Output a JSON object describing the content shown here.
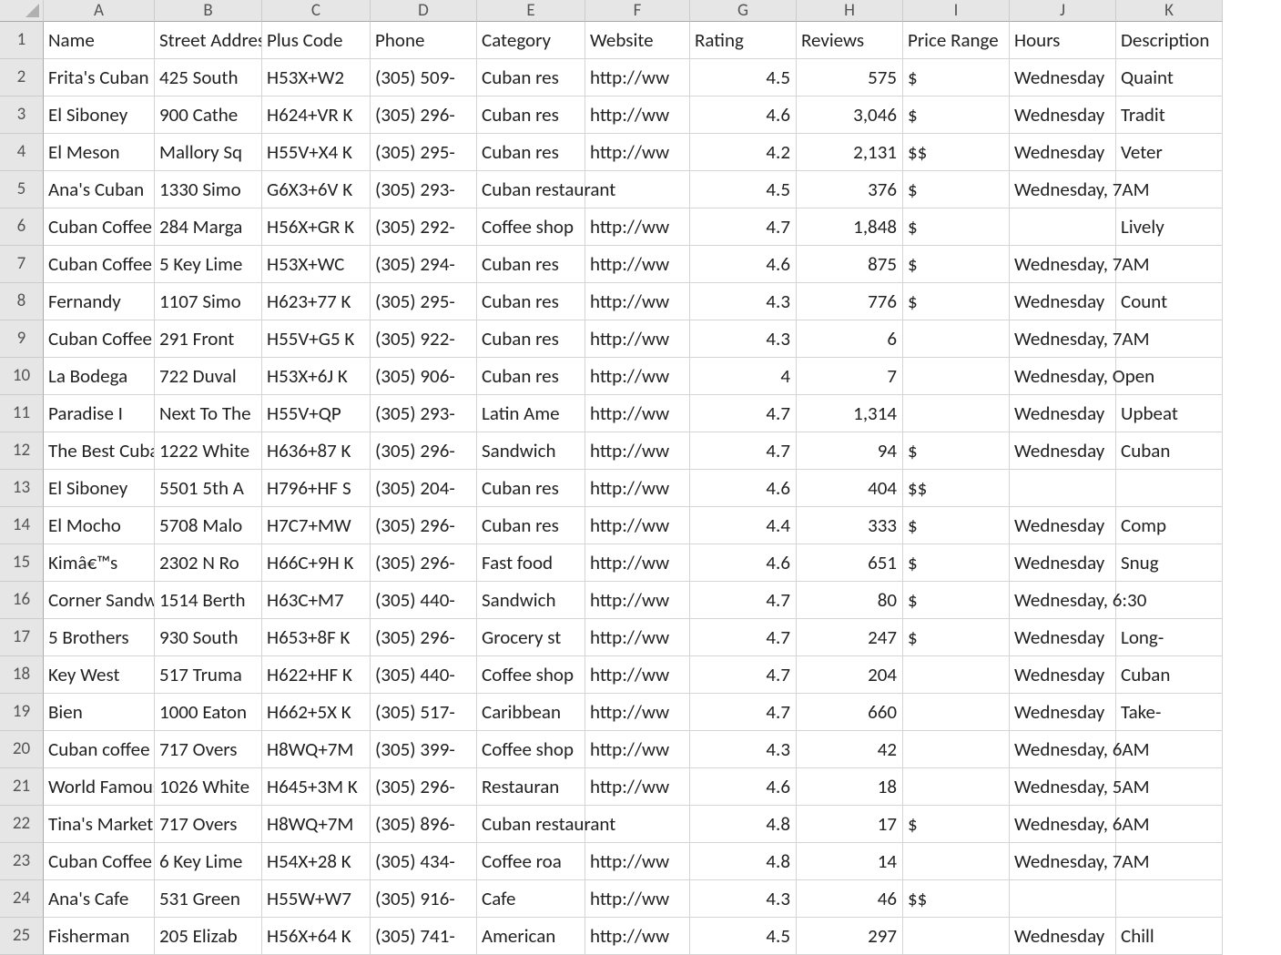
{
  "columns": [
    "A",
    "B",
    "C",
    "D",
    "E",
    "F",
    "G",
    "H",
    "I",
    "J",
    "K"
  ],
  "headers": {
    "A": "Name",
    "B": "Street Address",
    "C": "Plus Code",
    "D": "Phone",
    "E": "Category",
    "F": "Website",
    "G": "Rating",
    "H": "Reviews",
    "I": "Price Range",
    "J": "Hours",
    "K": "Description"
  },
  "rows": [
    {
      "n": "1",
      "A": "Name",
      "B": "Street Address",
      "C": "Plus Code",
      "D": "Phone",
      "E": "Category",
      "F": "Website",
      "G": "Rating",
      "H": "Reviews",
      "I": "Price Range",
      "J": "Hours",
      "K": "Description"
    },
    {
      "n": "2",
      "A": "Frita's Cuban",
      "B": "425 South",
      "C": "H53X+W2",
      "D": "(305) 509-",
      "E": "Cuban res",
      "F": "http://ww",
      "G": "4.5",
      "H": "575",
      "I": "$",
      "J": "Wednesday",
      "K": "Quaint"
    },
    {
      "n": "3",
      "A": "El Siboney",
      "B": "900 Cathe",
      "C": "H624+VR K",
      "D": "(305) 296-",
      "E": "Cuban res",
      "F": "http://ww",
      "G": "4.6",
      "H": "3,046",
      "I": "$",
      "J": "Wednesday",
      "K": "Tradit"
    },
    {
      "n": "4",
      "A": "El Meson",
      "B": "Mallory Sq",
      "C": "H55V+X4 K",
      "D": "(305) 295-",
      "E": "Cuban res",
      "F": "http://ww",
      "G": "4.2",
      "H": "2,131",
      "I": "$$",
      "J": "Wednesday",
      "K": "Veter"
    },
    {
      "n": "5",
      "A": "Ana's Cuban",
      "B": "1330 Simo",
      "C": "G6X3+6V K",
      "D": "(305) 293-",
      "E": "Cuban restaurant",
      "F": "",
      "G": "4.5",
      "H": "376",
      "I": "$",
      "J": "Wednesday, 7AM",
      "K": ""
    },
    {
      "n": "6",
      "A": "Cuban Coffee",
      "B": "284 Marga",
      "C": "H56X+GR K",
      "D": "(305) 292-",
      "E": "Coffee shop",
      "F": "http://ww",
      "G": "4.7",
      "H": "1,848",
      "I": "$",
      "J": "",
      "K": "Lively"
    },
    {
      "n": "7",
      "A": "Cuban Coffee",
      "B": "5 Key Lime",
      "C": "H53X+WC",
      "D": "(305) 294-",
      "E": "Cuban res",
      "F": "http://ww",
      "G": "4.6",
      "H": "875",
      "I": "$",
      "J": "Wednesday, 7AM",
      "K": ""
    },
    {
      "n": "8",
      "A": "Fernandy",
      "B": "1107 Simo",
      "C": "H623+77 K",
      "D": "(305) 295-",
      "E": "Cuban res",
      "F": "http://ww",
      "G": "4.3",
      "H": "776",
      "I": "$",
      "J": "Wednesday",
      "K": "Count"
    },
    {
      "n": "9",
      "A": "Cuban Coffee",
      "B": "291 Front",
      "C": "H55V+G5 K",
      "D": "(305) 922-",
      "E": "Cuban res",
      "F": "http://ww",
      "G": "4.3",
      "H": "6",
      "I": "",
      "J": "Wednesday, 7AM",
      "K": ""
    },
    {
      "n": "10",
      "A": "La Bodega",
      "B": "722 Duval",
      "C": "H53X+6J K",
      "D": "(305) 906-",
      "E": "Cuban res",
      "F": "http://ww",
      "G": "4",
      "H": "7",
      "I": "",
      "J": "Wednesday, Open",
      "K": ""
    },
    {
      "n": "11",
      "A": "Paradise I",
      "B": "Next To The",
      "C": "H55V+QP",
      "D": "(305) 293-",
      "E": "Latin Ame",
      "F": "http://ww",
      "G": "4.7",
      "H": "1,314",
      "I": "",
      "J": "Wednesday",
      "K": "Upbeat"
    },
    {
      "n": "12",
      "A": "The Best Cuban",
      "B": "1222 White",
      "C": "H636+87 K",
      "D": "(305) 296-",
      "E": "Sandwich",
      "F": "http://ww",
      "G": "4.7",
      "H": "94",
      "I": "$",
      "J": "Wednesday",
      "K": "Cuban"
    },
    {
      "n": "13",
      "A": "El Siboney",
      "B": "5501 5th A",
      "C": "H796+HF S",
      "D": "(305) 204-",
      "E": "Cuban res",
      "F": "http://ww",
      "G": "4.6",
      "H": "404",
      "I": "$$",
      "J": "",
      "K": ""
    },
    {
      "n": "14",
      "A": "El Mocho",
      "B": "5708 Malo",
      "C": "H7C7+MW",
      "D": "(305) 296-",
      "E": "Cuban res",
      "F": "http://ww",
      "G": "4.4",
      "H": "333",
      "I": "$",
      "J": "Wednesday",
      "K": "Comp"
    },
    {
      "n": "15",
      "A": "Kimâ€™s",
      "B": "2302 N Ro",
      "C": "H66C+9H K",
      "D": "(305) 296-",
      "E": "Fast food",
      "F": "http://ww",
      "G": "4.6",
      "H": "651",
      "I": "$",
      "J": "Wednesday",
      "K": "Snug "
    },
    {
      "n": "16",
      "A": "Corner Sandwich",
      "B": "1514 Berth",
      "C": "H63C+M7",
      "D": "(305) 440-",
      "E": "Sandwich",
      "F": "http://ww",
      "G": "4.7",
      "H": "80",
      "I": "$",
      "J": "Wednesday, 6:30",
      "K": ""
    },
    {
      "n": "17",
      "A": "5 Brothers",
      "B": "930 South",
      "C": "H653+8F K",
      "D": "(305) 296-",
      "E": "Grocery st",
      "F": "http://ww",
      "G": "4.7",
      "H": "247",
      "I": "$",
      "J": "Wednesday",
      "K": "Long-"
    },
    {
      "n": "18",
      "A": "Key West",
      "B": "517 Truma",
      "C": "H622+HF K",
      "D": "(305) 440-",
      "E": "Coffee shop",
      "F": "http://ww",
      "G": "4.7",
      "H": "204",
      "I": "",
      "J": "Wednesday",
      "K": "Cuban"
    },
    {
      "n": "19",
      "A": "Bien",
      "B": "1000 Eaton",
      "C": "H662+5X K",
      "D": "(305) 517-",
      "E": "Caribbean",
      "F": "http://ww",
      "G": "4.7",
      "H": "660",
      "I": "",
      "J": "Wednesday",
      "K": "Take-"
    },
    {
      "n": "20",
      "A": "Cuban coffee",
      "B": "717 Overs",
      "C": "H8WQ+7M",
      "D": "(305) 399-",
      "E": "Coffee shop",
      "F": "http://ww",
      "G": "4.3",
      "H": "42",
      "I": "",
      "J": "Wednesday, 6AM",
      "K": ""
    },
    {
      "n": "21",
      "A": "World Famous",
      "B": "1026 White",
      "C": "H645+3M K",
      "D": "(305) 296-",
      "E": "Restauran",
      "F": "http://ww",
      "G": "4.6",
      "H": "18",
      "I": "",
      "J": "Wednesday, 5AM",
      "K": ""
    },
    {
      "n": "22",
      "A": "Tina's Market",
      "B": "717 Overs",
      "C": "H8WQ+7M",
      "D": "(305) 896-",
      "E": "Cuban restaurant",
      "F": "",
      "G": "4.8",
      "H": "17",
      "I": "$",
      "J": "Wednesday, 6AM",
      "K": ""
    },
    {
      "n": "23",
      "A": "Cuban Coffee",
      "B": "6 Key Lime",
      "C": "H54X+28 K",
      "D": "(305) 434-",
      "E": "Coffee roa",
      "F": "http://ww",
      "G": "4.8",
      "H": "14",
      "I": "",
      "J": "Wednesday, 7AM",
      "K": ""
    },
    {
      "n": "24",
      "A": "Ana's Cafe",
      "B": "531 Green",
      "C": "H55W+W7",
      "D": "(305) 916-",
      "E": "Cafe",
      "F": "http://ww",
      "G": "4.3",
      "H": "46",
      "I": "$$",
      "J": "",
      "K": ""
    },
    {
      "n": "25",
      "A": "Fisherman",
      "B": "205 Elizab",
      "C": "H56X+64 K",
      "D": "(305) 741-",
      "E": "American",
      "F": "http://ww",
      "G": "4.5",
      "H": "297",
      "I": "",
      "J": "Wednesday",
      "K": "Chill"
    }
  ],
  "numericCols": [
    "G",
    "H"
  ]
}
